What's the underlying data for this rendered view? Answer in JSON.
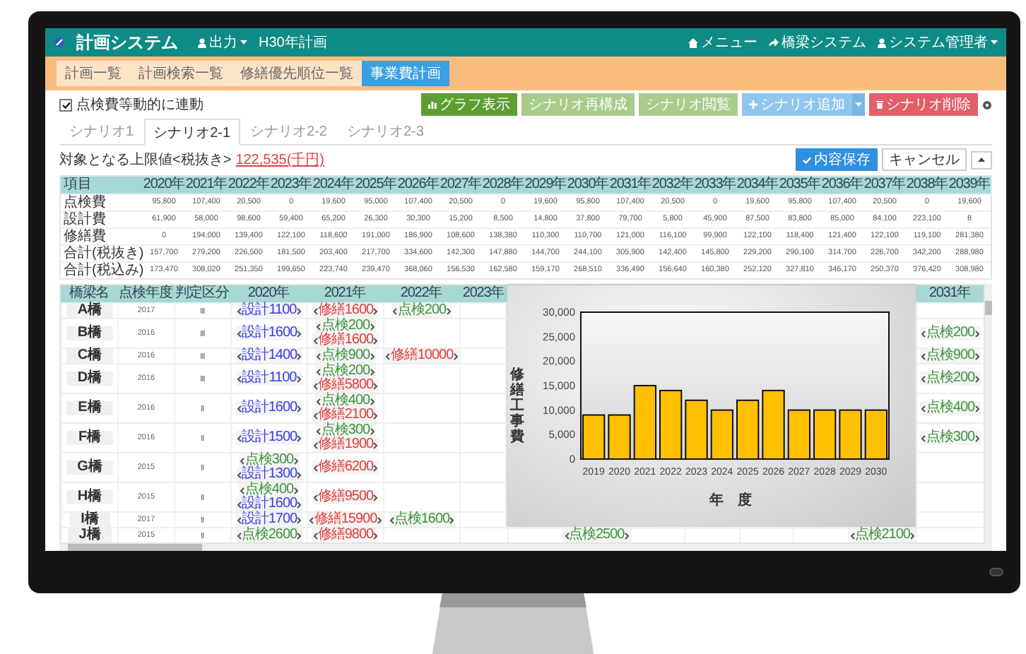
{
  "header": {
    "title": "計画システム",
    "menus": [
      {
        "label": "出力",
        "kind": "dropdown"
      },
      {
        "label": "H30年計画",
        "kind": "plain"
      }
    ],
    "right_links": [
      {
        "label": "メニュー",
        "kind": "home"
      },
      {
        "label": "橋梁システム",
        "kind": "share"
      },
      {
        "label": "システム管理者",
        "kind": "user"
      }
    ]
  },
  "nav_tabs": [
    {
      "label": "計画一覧",
      "selected": false
    },
    {
      "label": "計画検索一覧",
      "selected": false
    },
    {
      "label": "修繕優先順位一覧",
      "selected": false
    },
    {
      "label": "事業費計画",
      "selected": true
    }
  ],
  "sync_checkbox": {
    "label": "点検費等動的に連動",
    "checked": true
  },
  "toolbar_buttons": [
    {
      "label": "グラフ表示",
      "kind": "graph"
    },
    {
      "label": "シナリオ再構成",
      "kind": "light"
    },
    {
      "label": "シナリオ閲覧",
      "kind": "light"
    },
    {
      "label": "シナリオ追加",
      "kind": "add"
    },
    {
      "label": "シナリオ削除",
      "kind": "delete"
    }
  ],
  "scenario_tabs": [
    {
      "label": "シナリオ1",
      "selected": false
    },
    {
      "label": "シナリオ2-1",
      "selected": true
    },
    {
      "label": "シナリオ2-2",
      "selected": false
    },
    {
      "label": "シナリオ2-3",
      "selected": false
    }
  ],
  "limit": {
    "label": "対象となる上限値<税抜き>",
    "value": "122,535(千円)"
  },
  "actions": [
    {
      "label": "内容保存",
      "kind": "save"
    },
    {
      "label": "キャンセル",
      "kind": "cancel"
    }
  ],
  "summary_table": {
    "columns": [
      "項目",
      "2020年",
      "2021年",
      "2022年",
      "2023年",
      "2024年",
      "2025年",
      "2026年",
      "2027年",
      "2028年",
      "2029年",
      "2030年",
      "2031年",
      "2032年",
      "2033年",
      "2034年",
      "2035年",
      "2036年",
      "2037年",
      "2038年",
      "2039年"
    ],
    "rows": [
      {
        "label": "点検費",
        "values": [
          "95,800",
          "107,400",
          "20,500",
          "0",
          "19,600",
          "95,000",
          "107,400",
          "20,500",
          "0",
          "19,600",
          "95,800",
          "107,400",
          "20,500",
          "0",
          "19,600",
          "95,800",
          "107,400",
          "20,500",
          "0",
          "19,600"
        ]
      },
      {
        "label": "設計費",
        "values": [
          "61,900",
          "58,000",
          "98,600",
          "59,400",
          "65,200",
          "26,300",
          "30,300",
          "15,200",
          "8,500",
          "14,800",
          "37,800",
          "79,700",
          "5,800",
          "45,900",
          "87,500",
          "83,800",
          "85,000",
          "84,100",
          "223,100",
          "8"
        ]
      },
      {
        "label": "修繕費",
        "values": [
          "0",
          "194,000",
          "139,400",
          "122,100",
          "118,600",
          "191,000",
          "186,900",
          "108,600",
          "138,380",
          "110,300",
          "110,700",
          "121,000",
          "116,100",
          "99,900",
          "122,100",
          "118,400",
          "121,400",
          "122,100",
          "119,100",
          "281,380"
        ]
      },
      {
        "label": "合計(税抜き)",
        "values": [
          "157,700",
          "279,200",
          "226,500",
          "181,500",
          "203,400",
          "217,700",
          "334,600",
          "142,300",
          "147,880",
          "144,700",
          "244,100",
          "305,900",
          "142,400",
          "145,800",
          "229,200",
          "290,100",
          "314,700",
          "226,700",
          "342,200",
          "288,980"
        ]
      },
      {
        "label": "合計(税込み)",
        "values": [
          "173,470",
          "308,020",
          "251,350",
          "199,650",
          "223,740",
          "239,470",
          "368,060",
          "156,530",
          "162,580",
          "159,170",
          "268,510",
          "336,490",
          "156,640",
          "160,380",
          "252,120",
          "327,810",
          "346,170",
          "250,370",
          "376,420",
          "308,980"
        ]
      }
    ]
  },
  "bridge_table": {
    "columns": [
      "橋梁名",
      "点検年度",
      "判定区分"
    ],
    "year_columns": [
      "2020年",
      "2021年",
      "2022年",
      "2023年",
      null,
      null,
      null,
      null,
      null,
      null,
      null,
      "2031年"
    ],
    "rows": [
      {
        "name": "A橋",
        "inspected": "2017",
        "grade": "Ⅲ",
        "cells": [
          [
            {
              "kind": "design",
              "text": "設計1100"
            }
          ],
          [
            {
              "kind": "repair",
              "text": "修繕1600"
            }
          ],
          [
            {
              "kind": "inspect",
              "text": "点検200"
            }
          ],
          null,
          null,
          null,
          null,
          null,
          null,
          null,
          null,
          null
        ]
      },
      {
        "name": "B橋",
        "inspected": "2016",
        "grade": "Ⅲ",
        "cells": [
          [
            {
              "kind": "design",
              "text": "設計1600"
            }
          ],
          [
            {
              "kind": "inspect",
              "text": "点検200"
            },
            {
              "kind": "repair",
              "text": "修繕1600"
            }
          ],
          null,
          null,
          null,
          null,
          null,
          null,
          null,
          null,
          null,
          [
            {
              "kind": "inspect",
              "text": "点検200"
            }
          ]
        ]
      },
      {
        "name": "C橋",
        "inspected": "2016",
        "grade": "Ⅲ",
        "cells": [
          [
            {
              "kind": "design",
              "text": "設計1400"
            }
          ],
          [
            {
              "kind": "inspect",
              "text": "点検900"
            }
          ],
          [
            {
              "kind": "repair",
              "text": "修繕10000"
            }
          ],
          null,
          null,
          null,
          null,
          null,
          null,
          null,
          null,
          [
            {
              "kind": "inspect",
              "text": "点検900"
            }
          ]
        ]
      },
      {
        "name": "D橋",
        "inspected": "2016",
        "grade": "Ⅲ",
        "cells": [
          [
            {
              "kind": "design",
              "text": "設計1100"
            }
          ],
          [
            {
              "kind": "inspect",
              "text": "点検200"
            },
            {
              "kind": "repair",
              "text": "修繕5800"
            }
          ],
          null,
          null,
          null,
          null,
          null,
          null,
          null,
          null,
          null,
          [
            {
              "kind": "inspect",
              "text": "点検200"
            }
          ]
        ]
      },
      {
        "name": "E橋",
        "inspected": "2016",
        "grade": "Ⅱ",
        "cells": [
          [
            {
              "kind": "design",
              "text": "設計1600"
            }
          ],
          [
            {
              "kind": "inspect",
              "text": "点検400"
            },
            {
              "kind": "repair",
              "text": "修繕2100"
            }
          ],
          null,
          null,
          null,
          null,
          null,
          null,
          null,
          null,
          null,
          [
            {
              "kind": "inspect",
              "text": "点検400"
            }
          ]
        ]
      },
      {
        "name": "F橋",
        "inspected": "2016",
        "grade": "Ⅱ",
        "cells": [
          [
            {
              "kind": "design",
              "text": "設計1500"
            }
          ],
          [
            {
              "kind": "inspect",
              "text": "点検300"
            },
            {
              "kind": "repair",
              "text": "修繕1900"
            }
          ],
          null,
          null,
          null,
          null,
          null,
          null,
          null,
          null,
          null,
          [
            {
              "kind": "inspect",
              "text": "点検300"
            }
          ]
        ]
      },
      {
        "name": "G橋",
        "inspected": "2015",
        "grade": "Ⅱ",
        "cells": [
          [
            {
              "kind": "inspect",
              "text": "点検300"
            },
            {
              "kind": "design",
              "text": "設計1300"
            }
          ],
          [
            {
              "kind": "repair",
              "text": "修繕6200"
            }
          ],
          null,
          null,
          null,
          null,
          null,
          null,
          null,
          null,
          null,
          null
        ]
      },
      {
        "name": "H橋",
        "inspected": "2015",
        "grade": "Ⅱ",
        "cells": [
          [
            {
              "kind": "inspect",
              "text": "点検400"
            },
            {
              "kind": "design",
              "text": "設計1600"
            }
          ],
          [
            {
              "kind": "repair",
              "text": "修繕9500"
            }
          ],
          null,
          null,
          null,
          null,
          null,
          null,
          null,
          null,
          null,
          null
        ]
      },
      {
        "name": "I橋",
        "inspected": "2017",
        "grade": "Ⅱ",
        "cells": [
          [
            {
              "kind": "design",
              "text": "設計1700"
            }
          ],
          [
            {
              "kind": "repair",
              "text": "修繕15900"
            }
          ],
          [
            {
              "kind": "inspect",
              "text": "点検1600"
            }
          ],
          null,
          null,
          null,
          null,
          null,
          null,
          null,
          null,
          null
        ]
      },
      {
        "name": "J橋",
        "inspected": "2015",
        "grade": "Ⅱ",
        "cells": [
          [
            {
              "kind": "inspect",
              "text": "点検2600"
            }
          ],
          [
            {
              "kind": "repair",
              "text": "修繕9800"
            }
          ],
          null,
          null,
          null,
          [
            {
              "kind": "inspect",
              "text": "点検2500"
            }
          ],
          null,
          null,
          null,
          null,
          [
            {
              "kind": "inspect",
              "text": "点検2100"
            }
          ],
          null
        ]
      }
    ]
  },
  "chart_data": {
    "type": "bar",
    "xlabel": "年　度",
    "ylabel": "修繕工事費",
    "categories": [
      "2019",
      "2020",
      "2021",
      "2022",
      "2023",
      "2024",
      "2025",
      "2026",
      "2027",
      "2028",
      "2029",
      "2030"
    ],
    "series": [
      {
        "color": "#ffc000",
        "values": [
          9000,
          9000,
          15000,
          14000,
          12000,
          10000,
          12000,
          14000,
          10000,
          10000,
          10000,
          10000
        ]
      }
    ],
    "ylim": [
      0,
      30000
    ],
    "yticks": [
      {
        "value": 0,
        "label": "0"
      },
      {
        "value": 5000,
        "label": "5,000"
      },
      {
        "value": 10000,
        "label": "10,000"
      },
      {
        "value": 15000,
        "label": "15,000"
      },
      {
        "value": 20000,
        "label": "20,000"
      },
      {
        "value": 25000,
        "label": "25,000"
      },
      {
        "value": 30000,
        "label": "30,000"
      }
    ]
  }
}
